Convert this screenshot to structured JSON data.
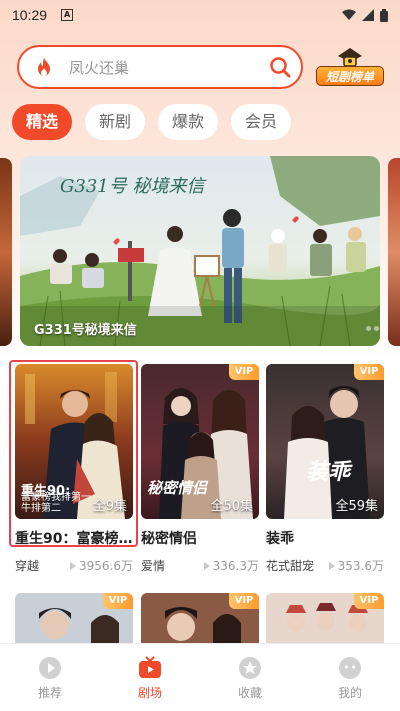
{
  "status_bar": {
    "time": "10:29",
    "notification_badge": "A"
  },
  "search": {
    "placeholder": "凤火还巢"
  },
  "rank_badge": {
    "label": "短剧榜单"
  },
  "tabs": [
    {
      "label": "精选",
      "active": true
    },
    {
      "label": "新剧",
      "active": false
    },
    {
      "label": "爆款",
      "active": false
    },
    {
      "label": "会员",
      "active": false
    }
  ],
  "banner": {
    "poster_title": "G331号 秘境来信",
    "caption": "G331号秘境来信",
    "dots": 3,
    "active_dot": 2
  },
  "cards": [
    {
      "title": "重生90：富豪榜…",
      "genre": "穿越",
      "views": "3956.6万",
      "episodes": "全9集",
      "vip": false,
      "overlay_title": "重生90:",
      "overlay_sub": "富豪榜我排第一 牛排第二"
    },
    {
      "title": "秘密情侣",
      "genre": "爱情",
      "views": "336.3万",
      "episodes": "全50集",
      "vip": true,
      "vip_label": "VIP",
      "poster_text": "秘密情侣"
    },
    {
      "title": "装乖",
      "genre": "花式甜宠",
      "views": "353.6万",
      "episodes": "全59集",
      "vip": true,
      "vip_label": "VIP",
      "poster_text": "装乖"
    }
  ],
  "row2_vip": [
    "VIP",
    "VIP",
    "VIP"
  ],
  "bottom_nav": [
    {
      "label": "推荐",
      "icon": "play-circle-icon",
      "active": false
    },
    {
      "label": "剧场",
      "icon": "tv-icon",
      "active": true
    },
    {
      "label": "收藏",
      "icon": "star-icon",
      "active": false
    },
    {
      "label": "我的",
      "icon": "face-icon",
      "active": false
    }
  ],
  "colors": {
    "accent": "#f04a2a",
    "vip": "#ff9b2e"
  }
}
